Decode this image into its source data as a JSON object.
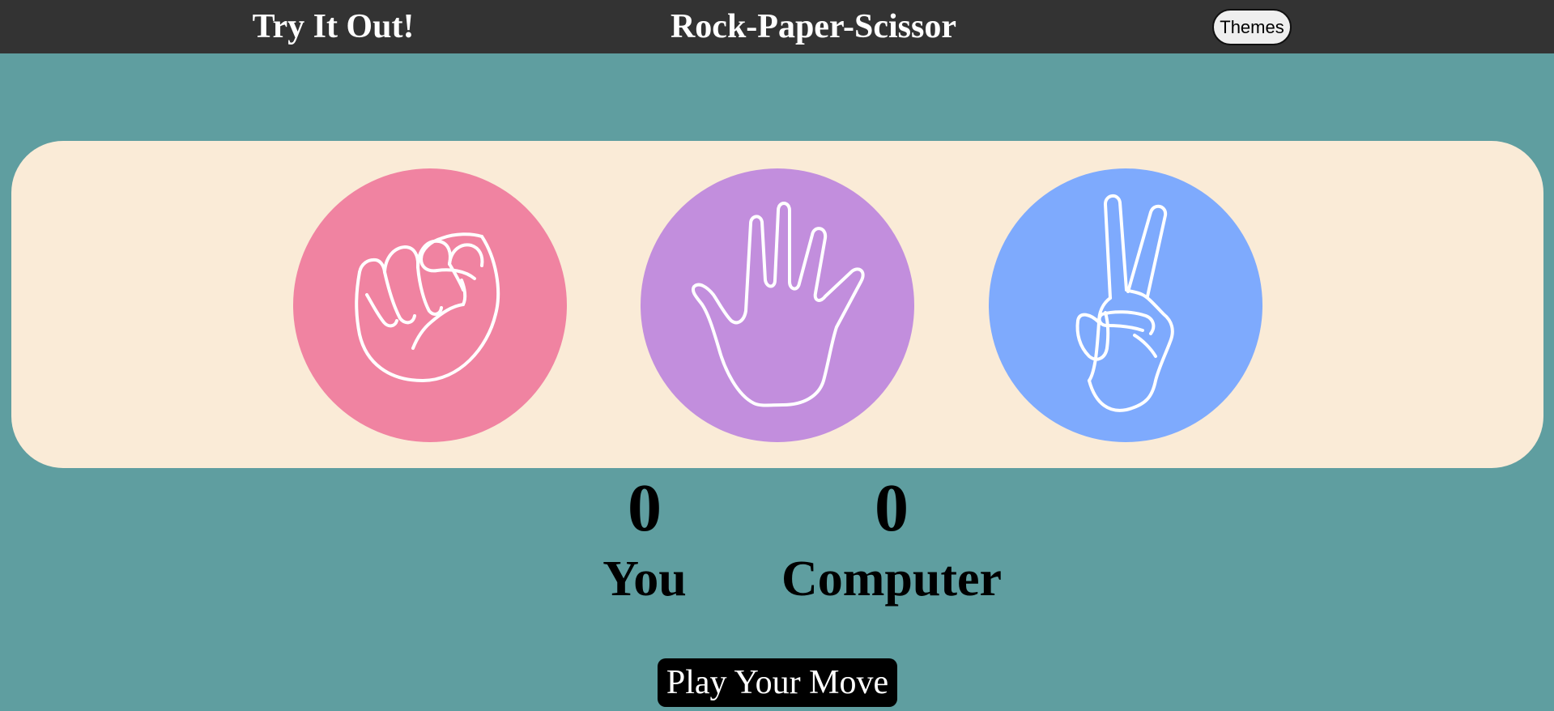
{
  "header": {
    "left_text": "Try It Out!",
    "title": "Rock-Paper-Scissor",
    "themes_label": "Themes"
  },
  "choices": [
    {
      "name": "rock",
      "icon": "fist-icon",
      "color": "#f083a1"
    },
    {
      "name": "paper",
      "icon": "open-hand-icon",
      "color": "#c28edd"
    },
    {
      "name": "scissor",
      "icon": "peace-hand-icon",
      "color": "#7eaafd"
    }
  ],
  "score": {
    "you_value": "0",
    "you_label": "You",
    "computer_value": "0",
    "computer_label": "Computer"
  },
  "play_button_label": "Play Your Move",
  "colors": {
    "background": "#5f9ea0",
    "topbar": "#333333",
    "board": "#faebd7"
  }
}
